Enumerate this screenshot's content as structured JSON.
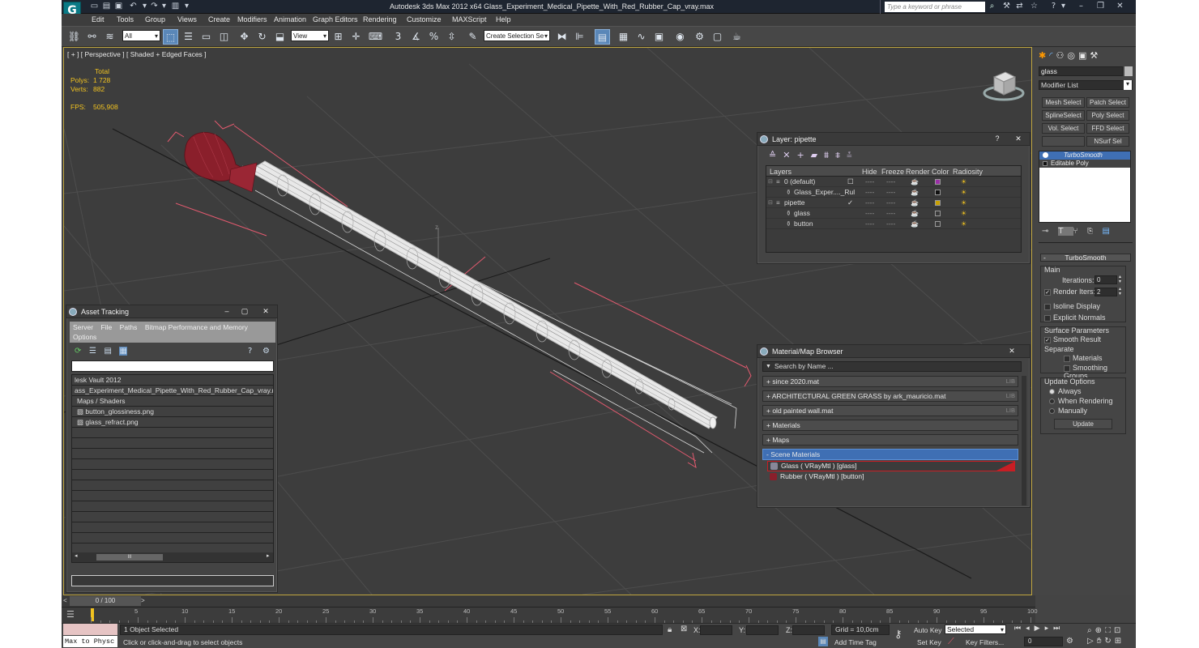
{
  "app": {
    "logo": "G",
    "title": "Autodesk 3ds Max  2012 x64      Glass_Experiment_Medical_Pipette_With_Red_Rubber_Cap_vray.max",
    "search_placeholder": "Type a keyword or phrase"
  },
  "menu": [
    "Edit",
    "Tools",
    "Group",
    "Views",
    "Create",
    "Modifiers",
    "Animation",
    "Graph Editors",
    "Rendering",
    "Customize",
    "MAXScript",
    "Help"
  ],
  "toolbar": {
    "selection_filter": "All",
    "reference_coord": "View",
    "named_selection": "Create Selection Se",
    "snap_label": "3",
    "angle_snap_label": "%"
  },
  "viewport": {
    "label": "[ + ] [ Perspective ] [ Shaded + Edged Faces ]",
    "stats": {
      "total_label": "Total",
      "polys_label": "Polys:",
      "polys_value": "1 728",
      "verts_label": "Verts:",
      "verts_value": "882",
      "fps_label": "FPS:",
      "fps_value": "505,908"
    },
    "z_axis": "z",
    "accent": "#bfa540"
  },
  "layer_panel": {
    "title": "Layer: pipette",
    "help": "?",
    "close": "✕",
    "columns": [
      "Layers",
      "Hide",
      "Freeze",
      "Render",
      "Color",
      "Radiosity"
    ],
    "rows": [
      {
        "name": "0 (default)",
        "indent": 0,
        "color": "#9b2fa7",
        "check": "☐"
      },
      {
        "name": "Glass_Exper...._Rul",
        "indent": 1,
        "color": "#111111",
        "check": ""
      },
      {
        "name": "pipette",
        "indent": 0,
        "color": "#c8a000",
        "check": "✓"
      },
      {
        "name": "glass",
        "indent": 1,
        "color": "#3a3a3a",
        "check": ""
      },
      {
        "name": "button",
        "indent": 1,
        "color": "#3a3a3a",
        "check": ""
      }
    ],
    "dash": "----"
  },
  "asset_panel": {
    "title": "Asset Tracking",
    "menu": [
      "Server",
      "File",
      "Paths",
      "Bitmap Performance and Memory",
      "Options"
    ],
    "rows": [
      "lesk Vault 2012",
      "ass_Experiment_Medical_Pipette_With_Red_Rubber_Cap_vray.max",
      "Maps / Shaders",
      "button_glossiness.png",
      "glass_refract.png"
    ],
    "scroll_grip": "III"
  },
  "material_panel": {
    "title": "Material/Map Browser",
    "search": "Search by Name ...",
    "close": "✕",
    "rows": [
      {
        "label": "+ since 2020.mat",
        "lib": "LIB"
      },
      {
        "label": "+ ARCHITECTURAL GREEN GRASS by ark_mauricio.mat",
        "lib": "LIB"
      },
      {
        "label": "+ old painted wall.mat",
        "lib": "LIB"
      },
      {
        "label": "+ Materials",
        "lib": ""
      },
      {
        "label": "+ Maps",
        "lib": ""
      }
    ],
    "scene_header": "- Scene Materials",
    "scene_items": [
      "Glass  ( VRayMtl )  [glass]",
      "Rubber  ( VRayMtl )  [button]"
    ],
    "glass_color": "#c81e24",
    "rubber_color": "#8a1f2b"
  },
  "command_panel": {
    "object_name": "glass",
    "modifier_list": "Modifier List",
    "buttons": [
      "Mesh Select",
      "Patch Select",
      "SplineSelect",
      "Poly Select",
      "Vol. Select",
      "FFD Select",
      "",
      "NSurf Sel"
    ],
    "stack": [
      "TurboSmooth",
      "Editable Poly"
    ],
    "rollout": "TurboSmooth",
    "main_label": "Main",
    "iterations_label": "Iterations:",
    "iterations_value": "0",
    "render_iters_label": "Render Iters:",
    "render_iters_value": "2",
    "isoline": "Isoline Display",
    "explicit": "Explicit Normals",
    "surface_label": "Surface Parameters",
    "smooth_result": "Smooth Result",
    "separate": "Separate",
    "materials": "Materials",
    "smoothing_groups": "Smoothing Groups",
    "update_label": "Update Options",
    "always": "Always",
    "when_rendering": "When Rendering",
    "manually": "Manually",
    "update_btn": "Update"
  },
  "timeline": {
    "frame": "0 / 100",
    "ticks": [
      "5",
      "10",
      "15",
      "20",
      "25",
      "30",
      "35",
      "40",
      "45",
      "50",
      "55",
      "60",
      "65",
      "70",
      "75",
      "80",
      "85",
      "90",
      "95",
      "100"
    ]
  },
  "status": {
    "maxscript": "Max to Physc",
    "selected": "1 Object Selected",
    "prompt": "Click or click-and-drag to select objects",
    "x_label": "X:",
    "y_label": "Y:",
    "z_label": "Z:",
    "grid": "Grid = 10,0cm",
    "add_time_tag": "Add Time Tag",
    "auto_key": "Auto Key",
    "set_key": "Set Key",
    "selected_dropdown": "Selected",
    "key_filters": "Key Filters...",
    "frame_value": "0"
  }
}
